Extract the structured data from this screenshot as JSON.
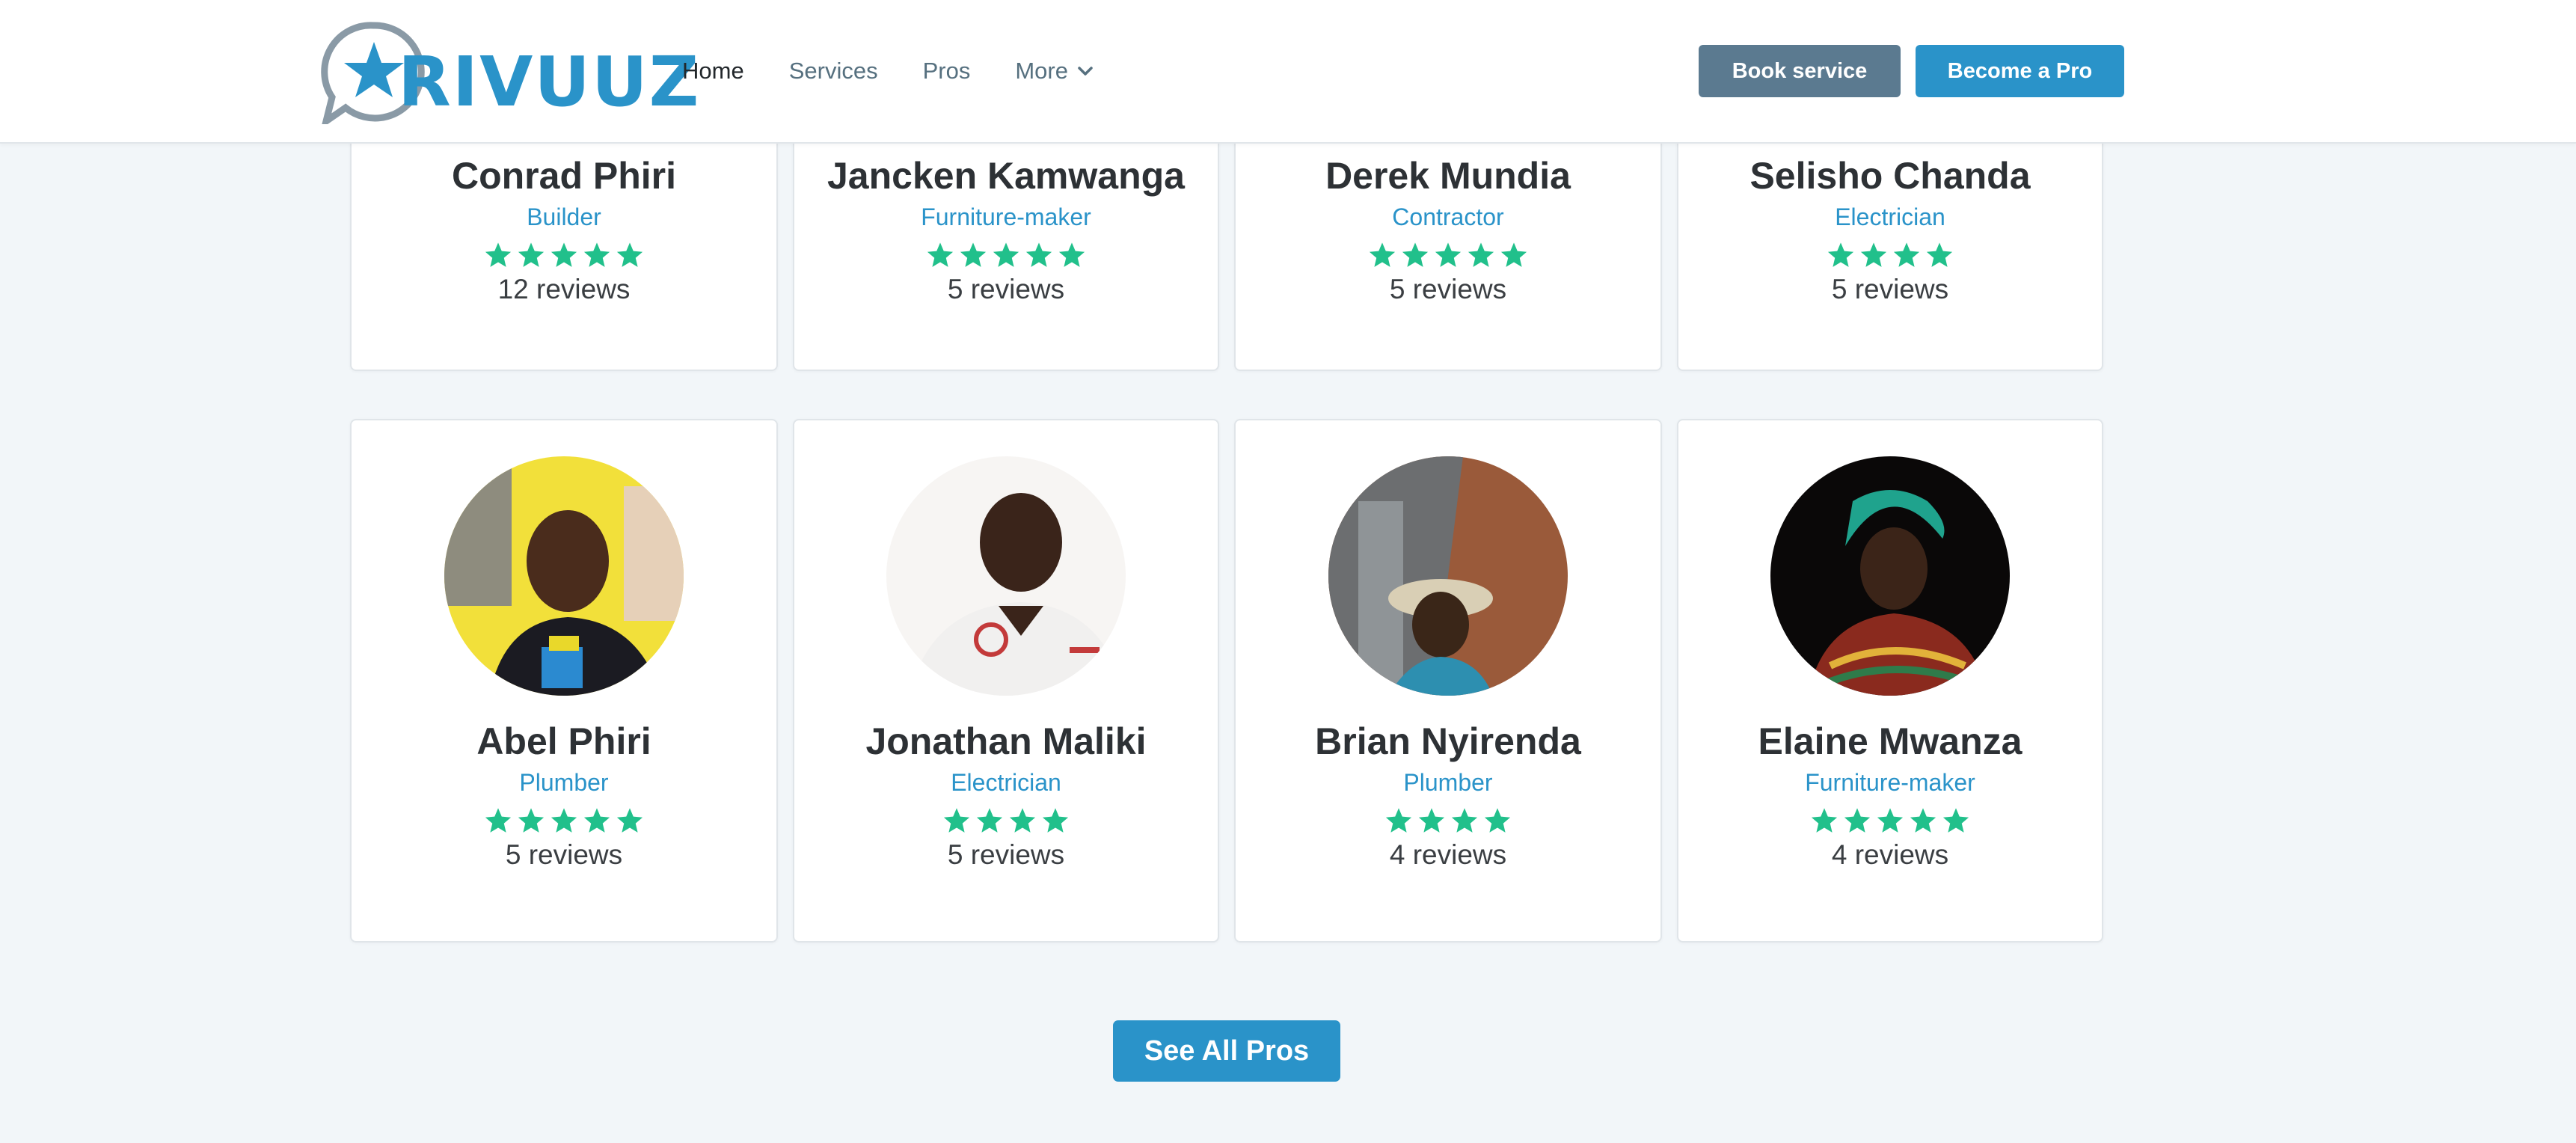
{
  "brand": {
    "logo_text": "RIVUUZ"
  },
  "nav": {
    "items": [
      {
        "label": "Home",
        "active": true
      },
      {
        "label": "Services",
        "active": false
      },
      {
        "label": "Pros",
        "active": false
      },
      {
        "label": "More",
        "active": false,
        "icon": "chevron-down-icon"
      }
    ]
  },
  "header_buttons": {
    "book": "Book service",
    "become_pro": "Become a Pro"
  },
  "colors": {
    "accent": "#2a93c9",
    "secondary": "#5b7a90",
    "star": "#21c08b",
    "background": "#f2f6f9"
  },
  "pros_top": [
    {
      "name": "Conrad Phiri",
      "trade": "Builder",
      "rating": 5,
      "reviews": "12 reviews"
    },
    {
      "name": "Jancken Kamwanga",
      "trade": "Furniture-maker",
      "rating": 5,
      "reviews": "5 reviews"
    },
    {
      "name": "Derek Mundia",
      "trade": "Contractor",
      "rating": 5,
      "reviews": "5 reviews"
    },
    {
      "name": "Selisho Chanda",
      "trade": "Electrician",
      "rating": 4,
      "reviews": "5 reviews"
    }
  ],
  "pros_bottom": [
    {
      "name": "Abel Phiri",
      "trade": "Plumber",
      "rating": 5,
      "reviews": "5 reviews"
    },
    {
      "name": "Jonathan Maliki",
      "trade": "Electrician",
      "rating": 4,
      "reviews": "5 reviews"
    },
    {
      "name": "Brian Nyirenda",
      "trade": "Plumber",
      "rating": 4,
      "reviews": "4 reviews"
    },
    {
      "name": "Elaine Mwanza",
      "trade": "Furniture-maker",
      "rating": 5,
      "reviews": "4 reviews"
    }
  ],
  "see_all": "See All Pros"
}
